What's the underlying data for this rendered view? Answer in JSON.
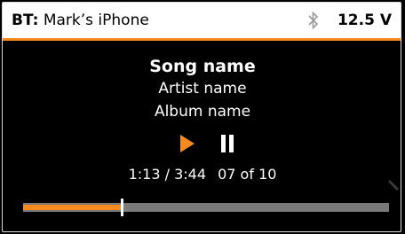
{
  "header": {
    "bt_prefix": "BT:",
    "device_name": "Mark’s iPhone",
    "bluetooth_icon": "bluetooth-icon",
    "voltage": "12.5 V"
  },
  "now_playing": {
    "song": "Song name",
    "artist": "Artist name",
    "album": "Album name"
  },
  "controls": {
    "play_icon": "play-icon",
    "pause_icon": "pause-icon"
  },
  "playback": {
    "elapsed": "1:13",
    "separator": "/",
    "duration": "3:44",
    "track_position": "07 of 10",
    "progress_fraction": 0.27
  },
  "colors": {
    "accent": "#f68a1e",
    "header_bg": "#ffffff",
    "screen_bg": "#000000",
    "track_bg": "#7a7a7a"
  }
}
